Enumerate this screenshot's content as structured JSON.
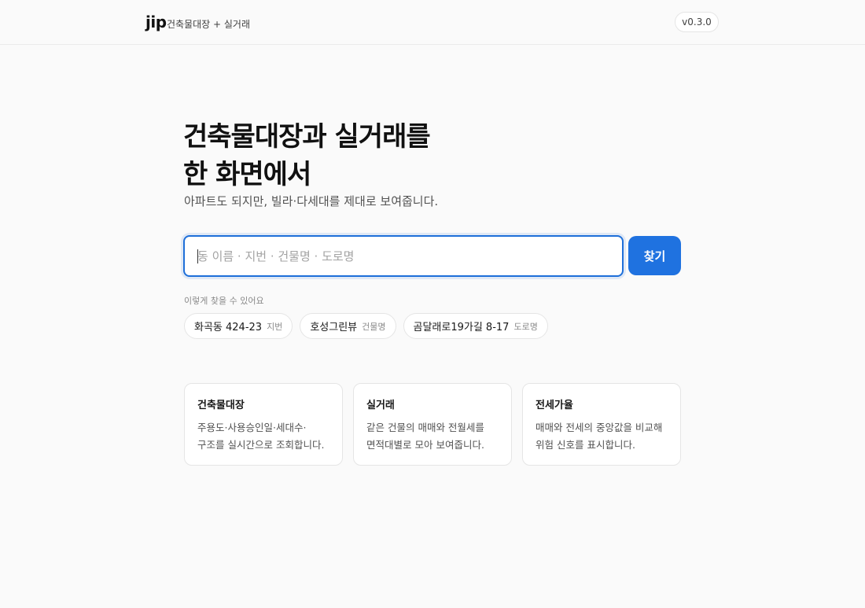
{
  "header": {
    "logo": "jip",
    "tagline": "건축물대장 + 실거래",
    "version": "v0.3.0"
  },
  "hero": {
    "title_line1": "건축물대장과 실거래를",
    "title_line2": "한 화면에서",
    "subtitle": "아파트도 되지만, 빌라·다세대를 제대로 보여줍니다."
  },
  "search": {
    "placeholder": "동 이름 · 지번 · 건물명 · 도로명",
    "value": "",
    "button_label": "찾기"
  },
  "examples": {
    "label": "이렇게 찾을 수 있어요",
    "items": [
      {
        "text": "화곡동 424-23",
        "type": "지번"
      },
      {
        "text": "호성그린뷰",
        "type": "건물명"
      },
      {
        "text": "곰달래로19가길 8-17",
        "type": "도로명"
      }
    ]
  },
  "features": [
    {
      "title": "건축물대장",
      "desc_line1": "주용도·사용승인일·세대수·",
      "desc_line2": "구조를 실시간으로 조회합니다."
    },
    {
      "title": "실거래",
      "desc_line1": "같은 건물의 매매와 전월세를",
      "desc_line2": "면적대별로 모아 보여줍니다."
    },
    {
      "title": "전세가율",
      "desc_line1": "매매와 전세의 중앙값을 비교해",
      "desc_line2": "위험 신호를 표시합니다."
    }
  ],
  "colors": {
    "accent": "#1f72e0",
    "background": "#fafafa"
  }
}
